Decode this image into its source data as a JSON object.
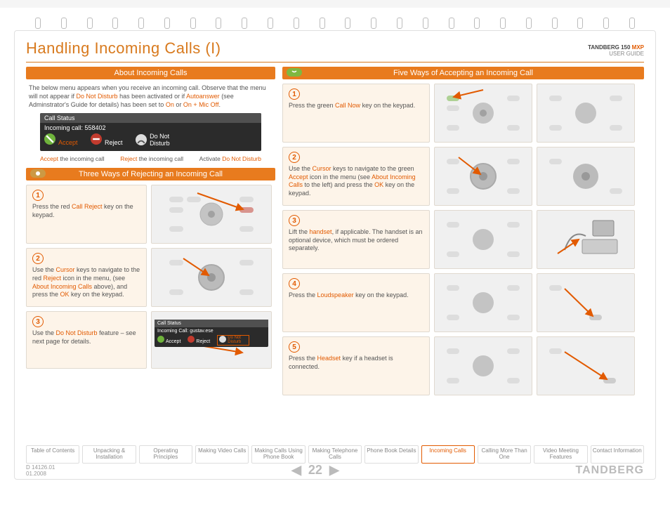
{
  "header": {
    "title": "Handling Incoming Calls (I)",
    "product_line1_a": "TANDBERG 150",
    "product_line1_b": "MXP",
    "product_line2": "USER GUIDE"
  },
  "bars": {
    "about": "About Incoming Calls",
    "three": "Three Ways of Rejecting an Incoming Call",
    "five": "Five Ways of Accepting an Incoming Call"
  },
  "about": {
    "p1a": "The below menu appears when you receive an incoming call. Observe that the menu will not appear if ",
    "p1b": "Do Not Disturb",
    "p1c": " has been activated or if ",
    "p1d": "Autoanswer",
    "p1e": " (see Adminstrator's Guide for details) has been set to ",
    "p1f": "On",
    "p1g": " or ",
    "p1h": "On + Mic Off",
    "p1i": "."
  },
  "menu": {
    "title": "Call Status",
    "line": "Incoming call: 558402",
    "accept": "Accept",
    "reject": "Reject",
    "dnd": "Do Not Disturb"
  },
  "caps": {
    "c1a": "Accept",
    "c1b": " the incoming call",
    "c2a": "Reject",
    "c2b": " the incoming call",
    "c3a": "Activate ",
    "c3b": "Do Not Disturb"
  },
  "reject": {
    "n1": "1",
    "t1a": "Press the red ",
    "t1b": "Call Reject",
    "t1c": " key on the keypad.",
    "n2": "2",
    "t2a": "Use the ",
    "t2b": "Cursor",
    "t2c": " keys to navigate to the red ",
    "t2d": "Reject",
    "t2e": " icon  in the menu, (see ",
    "t2f": "About Incoming Calls",
    "t2g": " above), and press the ",
    "t2h": "OK",
    "t2i": " key on the keypad.",
    "n3": "3",
    "t3a": "Use the ",
    "t3b": "Do Not Disturb",
    "t3c": " feature – see next page for details.",
    "mini_title": "Call Status",
    "mini_line": "Incoming Call: gustav.ese",
    "mini_accept": "Accept",
    "mini_reject": "Reject",
    "mini_dnd": "Do Not Disturb"
  },
  "accept": {
    "n1": "1",
    "t1a": "Press the green ",
    "t1b": "Call Now",
    "t1c": " key on the keypad.",
    "n2": "2",
    "t2a": "Use the ",
    "t2b": "Cursor",
    "t2c": " keys to navigate to the green ",
    "t2d": "Accept",
    "t2e": " icon in the menu (see ",
    "t2f": "About Incoming Calls",
    "t2g": " to the left) and press the ",
    "t2h": "OK",
    "t2i": " key on the keypad.",
    "n3": "3",
    "t3a": "Lift the ",
    "t3b": "handset",
    "t3c": ", if applicable. The handset is an optional device, which must be ordered separately.",
    "n4": "4",
    "t4a": "Press the ",
    "t4b": "Loudspeaker",
    "t4c": " key on the keypad.",
    "n5": "5",
    "t5a": "Press the ",
    "t5b": "Headset",
    "t5c": " key if a headset is connected."
  },
  "tabs": [
    "Table of Contents",
    "Unpacking & Installation",
    "Operating Principles",
    "Making Video Calls",
    "Making Calls Using Phone Book",
    "Making Telephone Calls",
    "Phone Book Details",
    "Incoming Calls",
    "Calling More Than One",
    "Video Meeting Features",
    "Contact Information"
  ],
  "footer": {
    "doc": "D 14126.01",
    "date": "01.2008",
    "page": "22",
    "brand": "TANDBERG"
  }
}
